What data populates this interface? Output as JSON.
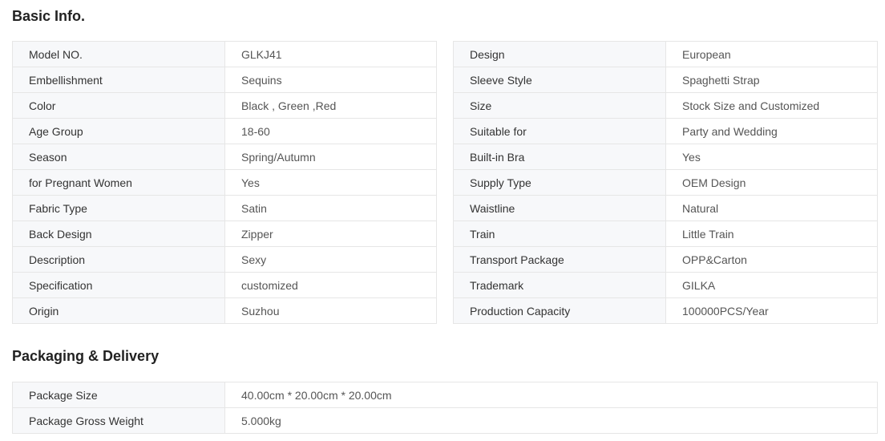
{
  "basic_info": {
    "title": "Basic Info.",
    "left": [
      {
        "label": "Model NO.",
        "value": "GLKJ41"
      },
      {
        "label": "Embellishment",
        "value": "Sequins"
      },
      {
        "label": "Color",
        "value": "Black , Green ,Red"
      },
      {
        "label": "Age Group",
        "value": "18-60"
      },
      {
        "label": "Season",
        "value": "Spring/Autumn"
      },
      {
        "label": "for Pregnant Women",
        "value": "Yes"
      },
      {
        "label": "Fabric Type",
        "value": "Satin"
      },
      {
        "label": "Back Design",
        "value": "Zipper"
      },
      {
        "label": "Description",
        "value": "Sexy"
      },
      {
        "label": "Specification",
        "value": "customized"
      },
      {
        "label": "Origin",
        "value": "Suzhou"
      }
    ],
    "right": [
      {
        "label": "Design",
        "value": "European"
      },
      {
        "label": "Sleeve Style",
        "value": "Spaghetti Strap"
      },
      {
        "label": "Size",
        "value": "Stock Size and Customized"
      },
      {
        "label": "Suitable for",
        "value": "Party and Wedding"
      },
      {
        "label": "Built-in Bra",
        "value": "Yes"
      },
      {
        "label": "Supply Type",
        "value": "OEM Design"
      },
      {
        "label": "Waistline",
        "value": "Natural"
      },
      {
        "label": "Train",
        "value": "Little Train"
      },
      {
        "label": "Transport Package",
        "value": "OPP&Carton"
      },
      {
        "label": "Trademark",
        "value": "GILKA"
      },
      {
        "label": "Production Capacity",
        "value": "100000PCS/Year"
      }
    ]
  },
  "packaging": {
    "title": "Packaging & Delivery",
    "rows": [
      {
        "label": "Package Size",
        "value": "40.00cm * 20.00cm * 20.00cm"
      },
      {
        "label": "Package Gross Weight",
        "value": "5.000kg"
      }
    ]
  },
  "colors": {
    "label_bg": "#f7f8fa",
    "border": "#e6e6e6",
    "label_text": "#333333",
    "value_text": "#555555"
  }
}
